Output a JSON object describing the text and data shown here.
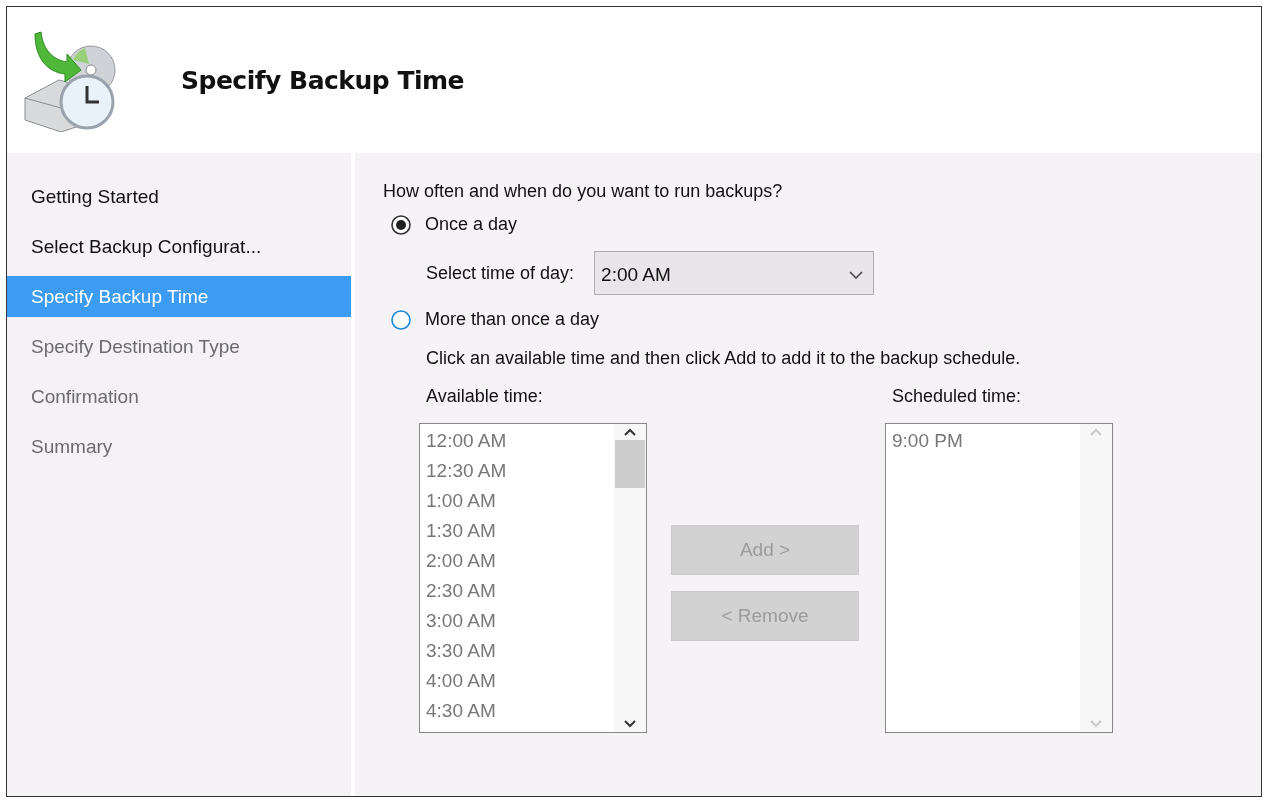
{
  "window": {
    "title": "Specify Backup Time"
  },
  "steps": [
    {
      "label": "Getting Started",
      "selected": false,
      "disabled": false
    },
    {
      "label": "Select Backup Configurat...",
      "selected": false,
      "disabled": false
    },
    {
      "label": "Specify Backup Time",
      "selected": true,
      "disabled": false
    },
    {
      "label": "Specify Destination Type",
      "selected": false,
      "disabled": true
    },
    {
      "label": "Confirmation",
      "selected": false,
      "disabled": true
    },
    {
      "label": "Summary",
      "selected": false,
      "disabled": true
    }
  ],
  "question": "How often and when do you want to run backups?",
  "options": [
    {
      "label": "Once a day",
      "selected": true
    },
    {
      "label": "More than once a day",
      "selected": false
    }
  ],
  "time_of_day": {
    "label": "Select time of day:",
    "value": "2:00 AM",
    "disabled": false
  },
  "instruction": "Click an available time and then click Add to add it to the backup schedule.",
  "available": {
    "label": "Available time:",
    "disabled": true,
    "items": [
      "12:00 AM",
      "12:30 AM",
      "1:00 AM",
      "1:30 AM",
      "2:00 AM",
      "2:30 AM",
      "3:00 AM",
      "3:30 AM",
      "4:00 AM",
      "4:30 AM"
    ]
  },
  "buttons": [
    {
      "label": "Add >",
      "disabled": true
    },
    {
      "label": "< Remove",
      "disabled": true
    }
  ],
  "scheduled": {
    "label": "Scheduled time:",
    "disabled": true,
    "items": [
      "9:00 PM"
    ]
  }
}
